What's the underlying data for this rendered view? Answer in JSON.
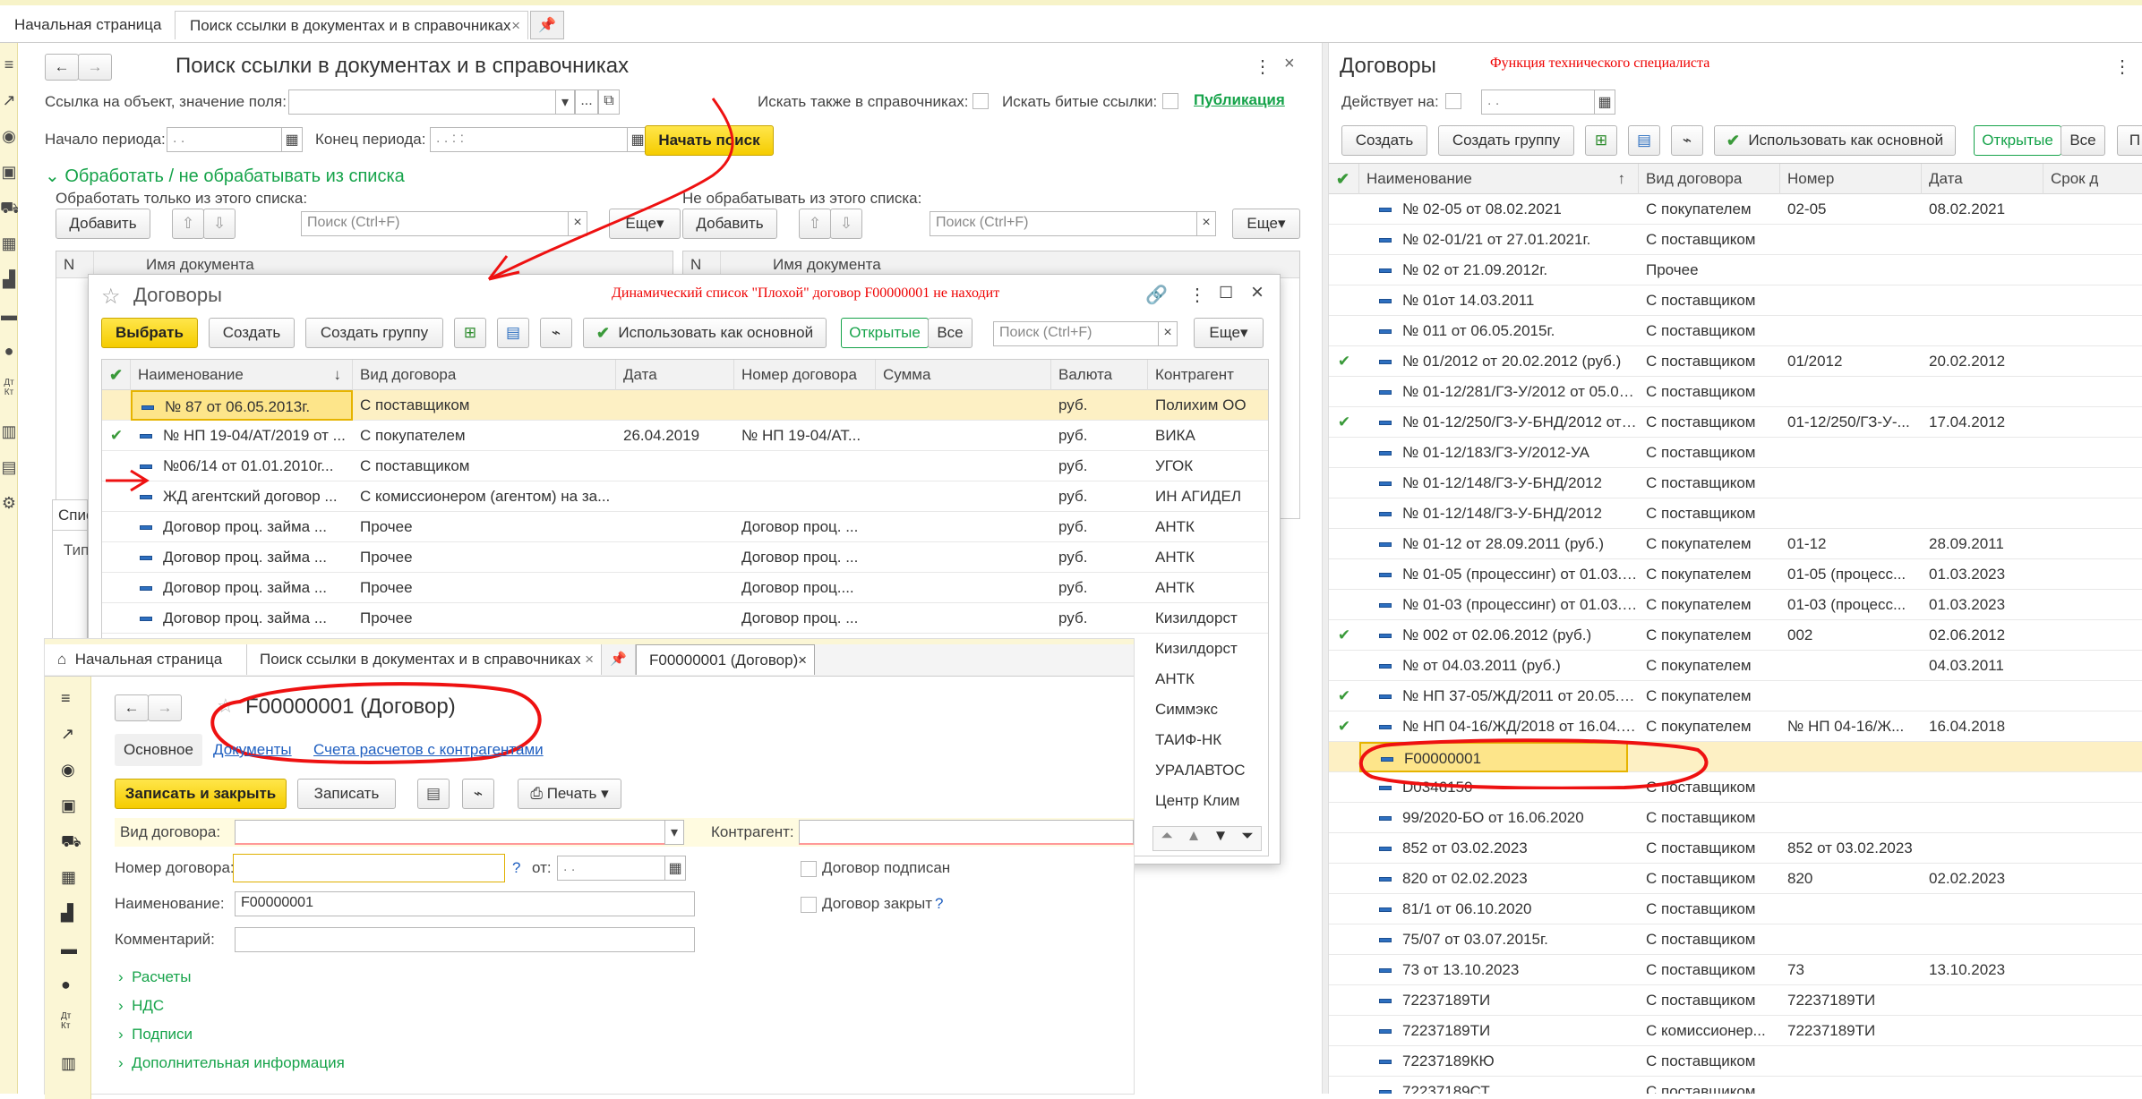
{
  "tabs": {
    "home": "Начальная страница",
    "search": "Поиск ссылки в документах и в справочниках",
    "close": "×"
  },
  "search_form": {
    "title": "Поиск ссылки в документах и в справочниках",
    "ref_label": "Ссылка на объект, значение поля:",
    "also_catalogs": "Искать также в справочниках:",
    "broken_links": "Искать битые ссылки:",
    "publication": "Публикация",
    "period_start": "Начало периода:",
    "period_end": "Конец периода:",
    "date_ph": " .  .",
    "datetime_ph": " .  .     :  :",
    "start_search": "Начать поиск",
    "group_title": "Обработать / не обрабатывать из списка",
    "process_only": "Обработать только из этого списка:",
    "not_process": "Не обрабатывать из этого списка:",
    "add": "Добавить",
    "search_ph": "Поиск (Ctrl+F)",
    "more": "Еще",
    "col_n": "N",
    "col_docname": "Имя документа",
    "list_tab": "Спис",
    "type_col": "Тип"
  },
  "dialog": {
    "title": "Договоры",
    "annotation": "Динамический список  \"Плохой\" договор F00000001 не находит",
    "select": "Выбрать",
    "create": "Создать",
    "create_group": "Создать группу",
    "use_main": "Использовать как основной",
    "open": "Открытые",
    "all": "Все",
    "search_ph": "Поиск (Ctrl+F)",
    "more": "Еще",
    "columns": [
      "Наименование",
      "Вид договора",
      "Дата",
      "Номер договора",
      "Сумма",
      "Валюта",
      "Контрагент"
    ],
    "rows": [
      {
        "check": "",
        "name": "№ 87 от 06.05.2013г.",
        "kind": "С поставщиком",
        "date": "",
        "num": "",
        "sum": "",
        "cur": "руб.",
        "cp": "Полихим ОО"
      },
      {
        "check": "✔",
        "name": "№ НП 19-04/АТ/2019 от ...",
        "kind": "С покупателем",
        "date": "26.04.2019",
        "num": "№ НП 19-04/АТ...",
        "sum": "",
        "cur": "руб.",
        "cp": "ВИКА"
      },
      {
        "check": "",
        "name": "№06/14 от 01.01.2010г...",
        "kind": "С поставщиком",
        "date": "",
        "num": "",
        "sum": "",
        "cur": "руб.",
        "cp": "УГОК"
      },
      {
        "check": "",
        "name": "ЖД агентский договор ...",
        "kind": "С комиссионером (агентом) на за...",
        "date": "",
        "num": "",
        "sum": "",
        "cur": "руб.",
        "cp": "ИН АГИДЕЛ"
      },
      {
        "check": "",
        "name": "Договор проц. займа ...",
        "kind": "Прочее",
        "date": "",
        "num": "Договор проц. ...",
        "sum": "",
        "cur": "руб.",
        "cp": "АНТК"
      },
      {
        "check": "",
        "name": "Договор проц. займа ...",
        "kind": "Прочее",
        "date": "",
        "num": "Договор проц. ...",
        "sum": "",
        "cur": "руб.",
        "cp": "АНТК"
      },
      {
        "check": "",
        "name": "Договор проц. займа ...",
        "kind": "Прочее",
        "date": "",
        "num": " Договор проц....",
        "sum": "",
        "cur": "руб.",
        "cp": "АНТК"
      },
      {
        "check": "",
        "name": "Договор проц. займа ...",
        "kind": "Прочее",
        "date": "",
        "num": "Договор проц. ...",
        "sum": "",
        "cur": "руб.",
        "cp": "Кизилдорст"
      }
    ],
    "extra_cp": [
      "Кизилдорст",
      "АНТК",
      "Симмэкс",
      "ТАИФ-НК",
      "УРАЛАВТОС",
      "Центр Клим"
    ]
  },
  "contract": {
    "tab_home": "Начальная страница",
    "tab_search": "Поиск ссылки в документах и в справочниках",
    "tab_contract": "F00000001 (Договор)",
    "title": "F00000001 (Договор)",
    "tabs": [
      "Основное",
      "Документы",
      "Счета расчетов с контрагентами"
    ],
    "save_close": "Записать и закрыть",
    "save": "Записать",
    "print": "Печать",
    "kind_label": "Вид договора:",
    "counterparty_label": "Контрагент:",
    "number_label": "Номер договора:",
    "help": "?",
    "from_label": "от:",
    "signed": "Договор подписан",
    "closed": "Договор закрыт",
    "name_label": "Наименование:",
    "name_value": "F00000001",
    "comment_label": "Комментарий:",
    "groups": [
      "Расчеты",
      "НДС",
      "Подписи",
      "Дополнительная информация"
    ]
  },
  "right": {
    "title": "Договоры",
    "subtitle": "Функция технического специалиста",
    "active_on": "Действует на:",
    "date_ph": " .  .",
    "create": "Создать",
    "create_group": "Создать группу",
    "use_main": "Использовать как основной",
    "open": "Открытые",
    "all": "Все",
    "columns": [
      "Наименование",
      "Вид договора",
      "Номер",
      "Дата",
      "Срок д"
    ],
    "rows": [
      {
        "check": "",
        "name": "№ 02-05 от 08.02.2021",
        "kind": "С покупателем",
        "num": "02-05",
        "date": "08.02.2021"
      },
      {
        "check": "",
        "name": "№ 02-01/21 от 27.01.2021г.",
        "kind": "С поставщиком",
        "num": "",
        "date": ""
      },
      {
        "check": "",
        "name": "№ 02 от 21.09.2012г.",
        "kind": "Прочее",
        "num": "",
        "date": ""
      },
      {
        "check": "",
        "name": "№ 01от 14.03.2011",
        "kind": "С поставщиком",
        "num": "",
        "date": ""
      },
      {
        "check": "",
        "name": "№ 011 от  06.05.2015г.",
        "kind": "С поставщиком",
        "num": "",
        "date": ""
      },
      {
        "check": "✔",
        "name": "№ 01/2012 от 20.02.2012 (руб.)",
        "kind": "С поставщиком",
        "num": "01/2012",
        "date": "20.02.2012"
      },
      {
        "check": "",
        "name": "№ 01-12/281/ГЗ-У/2012 от 05.06.2...",
        "kind": "С поставщиком",
        "num": "",
        "date": ""
      },
      {
        "check": "✔",
        "name": "№ 01-12/250/ГЗ-У-БНД/2012 от 17...",
        "kind": "С поставщиком",
        "num": "01-12/250/ГЗ-У-...",
        "date": "17.04.2012"
      },
      {
        "check": "",
        "name": "№ 01-12/183/ГЗ-У/2012-УА",
        "kind": "С поставщиком",
        "num": "",
        "date": ""
      },
      {
        "check": "",
        "name": "№ 01-12/148/ГЗ-У-БНД/2012",
        "kind": "С поставщиком",
        "num": "",
        "date": ""
      },
      {
        "check": "",
        "name": "№ 01-12/148/ГЗ-У-БНД/2012",
        "kind": "С поставщиком",
        "num": "",
        "date": ""
      },
      {
        "check": "",
        "name": "№ 01-12 от 28.09.2011 (руб.)",
        "kind": "С покупателем",
        "num": "01-12",
        "date": "28.09.2011"
      },
      {
        "check": "",
        "name": "№ 01-05 (процессинг) от 01.03.2023",
        "kind": "С покупателем",
        "num": "01-05 (процесс...",
        "date": "01.03.2023"
      },
      {
        "check": "",
        "name": "№ 01-03 (процессинг) от 01.03.2023",
        "kind": "С покупателем",
        "num": "01-03 (процесс...",
        "date": "01.03.2023"
      },
      {
        "check": "✔",
        "name": "№ 002 от 02.06.2012 (руб.)",
        "kind": "С покупателем",
        "num": "002",
        "date": "02.06.2012"
      },
      {
        "check": "",
        "name": "№  от 04.03.2011 (руб.)",
        "kind": "С покупателем",
        "num": "",
        "date": "04.03.2011"
      },
      {
        "check": "✔",
        "name": "№  НП 37-05/ЖД/2011 от 20.05.20...",
        "kind": "С покупателем",
        "num": "",
        "date": ""
      },
      {
        "check": "✔",
        "name": "№  НП 04-16/ЖД/2018 от 16.04.20...",
        "kind": "С покупателем",
        "num": "№  НП 04-16/Ж...",
        "date": "16.04.2018"
      },
      {
        "check": "",
        "name": "F00000001",
        "kind": "",
        "num": "",
        "date": ""
      },
      {
        "check": "",
        "name": "D0346150",
        "kind": "С поставщиком",
        "num": "",
        "date": ""
      },
      {
        "check": "",
        "name": "99/2020-БО от 16.06.2020",
        "kind": "С поставщиком",
        "num": "",
        "date": ""
      },
      {
        "check": "",
        "name": "852 от 03.02.2023",
        "kind": "С поставщиком",
        "num": "852 от 03.02.2023",
        "date": ""
      },
      {
        "check": "",
        "name": "820 от 02.02.2023",
        "kind": "С поставщиком",
        "num": "820",
        "date": "02.02.2023"
      },
      {
        "check": "",
        "name": "81/1 от 06.10.2020",
        "kind": "С поставщиком",
        "num": "",
        "date": ""
      },
      {
        "check": "",
        "name": "75/07 от 03.07.2015г.",
        "kind": "С поставщиком",
        "num": "",
        "date": ""
      },
      {
        "check": "",
        "name": "73 от 13.10.2023",
        "kind": "С поставщиком",
        "num": "73",
        "date": "13.10.2023"
      },
      {
        "check": "",
        "name": "72237189ТИ",
        "kind": "С поставщиком",
        "num": "72237189ТИ",
        "date": ""
      },
      {
        "check": "",
        "name": "72237189ТИ",
        "kind": "С комиссионер...",
        "num": "72237189ТИ",
        "date": ""
      },
      {
        "check": "",
        "name": "72237189КЮ",
        "kind": "С поставщиком",
        "num": "",
        "date": ""
      },
      {
        "check": "",
        "name": "72237189СТ",
        "kind": "С поставщиком",
        "num": "",
        "date": ""
      }
    ]
  }
}
